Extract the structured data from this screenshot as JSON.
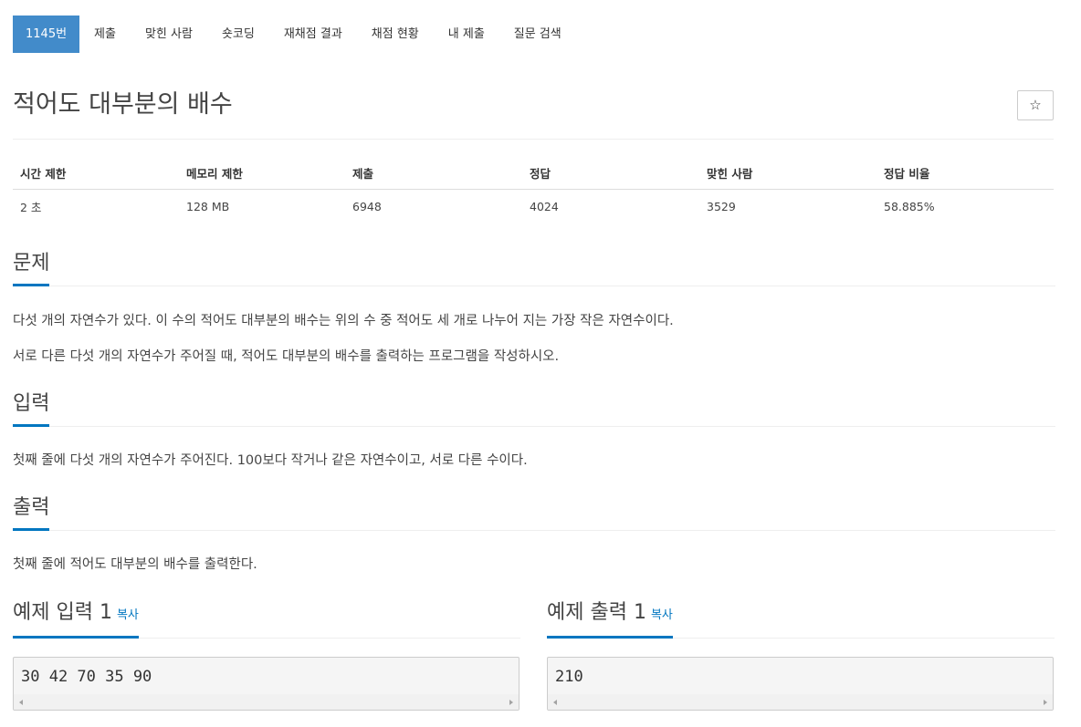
{
  "tabs": [
    {
      "label": "1145번",
      "active": true
    },
    {
      "label": "제출"
    },
    {
      "label": "맞힌 사람"
    },
    {
      "label": "숏코딩"
    },
    {
      "label": "재채점 결과"
    },
    {
      "label": "채점 현황"
    },
    {
      "label": "내 제출"
    },
    {
      "label": "질문 검색"
    }
  ],
  "problem": {
    "title": "적어도 대부분의 배수",
    "star_icon": "☆"
  },
  "info_table": {
    "headers": [
      "시간 제한",
      "메모리 제한",
      "제출",
      "정답",
      "맞힌 사람",
      "정답 비율"
    ],
    "values": [
      "2 초",
      "128 MB",
      "6948",
      "4024",
      "3529",
      "58.885%"
    ]
  },
  "sections": {
    "problem": {
      "title": "문제",
      "paragraphs": [
        "다섯 개의 자연수가 있다. 이 수의 적어도 대부분의 배수는 위의 수 중 적어도 세 개로 나누어 지는 가장 작은 자연수이다.",
        "서로 다른 다섯 개의 자연수가 주어질 때, 적어도 대부분의 배수를 출력하는 프로그램을 작성하시오."
      ]
    },
    "input": {
      "title": "입력",
      "text": "첫째 줄에 다섯 개의 자연수가 주어진다. 100보다 작거나 같은 자연수이고, 서로 다른 수이다."
    },
    "output": {
      "title": "출력",
      "text": "첫째 줄에 적어도 대부분의 배수를 출력한다."
    }
  },
  "samples": {
    "copy_label": "복사",
    "input": {
      "title": "예제 입력 1",
      "content": "30 42 70 35 90"
    },
    "output": {
      "title": "예제 출력 1",
      "content": "210"
    }
  },
  "colors": {
    "tab_active": "#428bca",
    "accent": "#0076c0"
  }
}
